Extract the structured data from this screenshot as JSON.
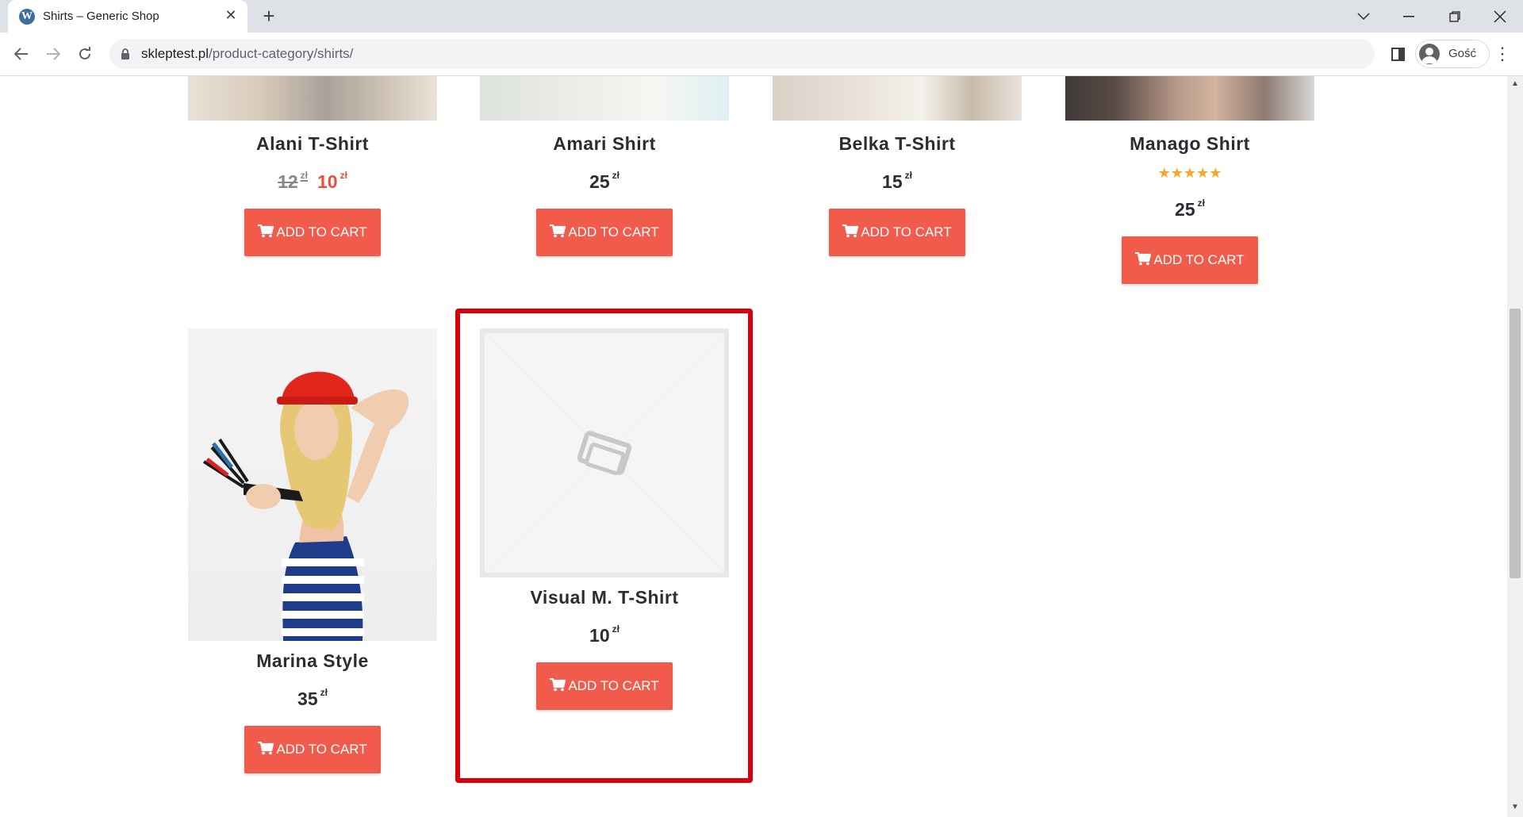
{
  "browser": {
    "tab_title": "Shirts – Generic Shop",
    "favicon_letter": "W",
    "url_domain": "skleptest.pl",
    "url_path": "/product-category/shirts/",
    "profile_name": "Gość"
  },
  "colors": {
    "accent_button": "#f05b4b",
    "sale_price": "#e94d3f",
    "highlight_border": "#d9000d",
    "star": "#f5a623"
  },
  "products": [
    {
      "name": "Alani T-Shirt",
      "old_price": "12",
      "price": "10",
      "currency": "zł",
      "button": "ADD TO CART"
    },
    {
      "name": "Amari Shirt",
      "price": "25",
      "currency": "zł",
      "button": "ADD TO CART"
    },
    {
      "name": "Belka T-Shirt",
      "price": "15",
      "currency": "zł",
      "button": "ADD TO CART"
    },
    {
      "name": "Manago Shirt",
      "rating": 5,
      "price": "25",
      "currency": "zł",
      "button": "ADD TO CART"
    },
    {
      "name": "Marina Style",
      "price": "35",
      "currency": "zł",
      "button": "ADD TO CART"
    },
    {
      "name": "Visual M. T-Shirt",
      "price": "10",
      "currency": "zł",
      "button": "ADD TO CART"
    }
  ]
}
